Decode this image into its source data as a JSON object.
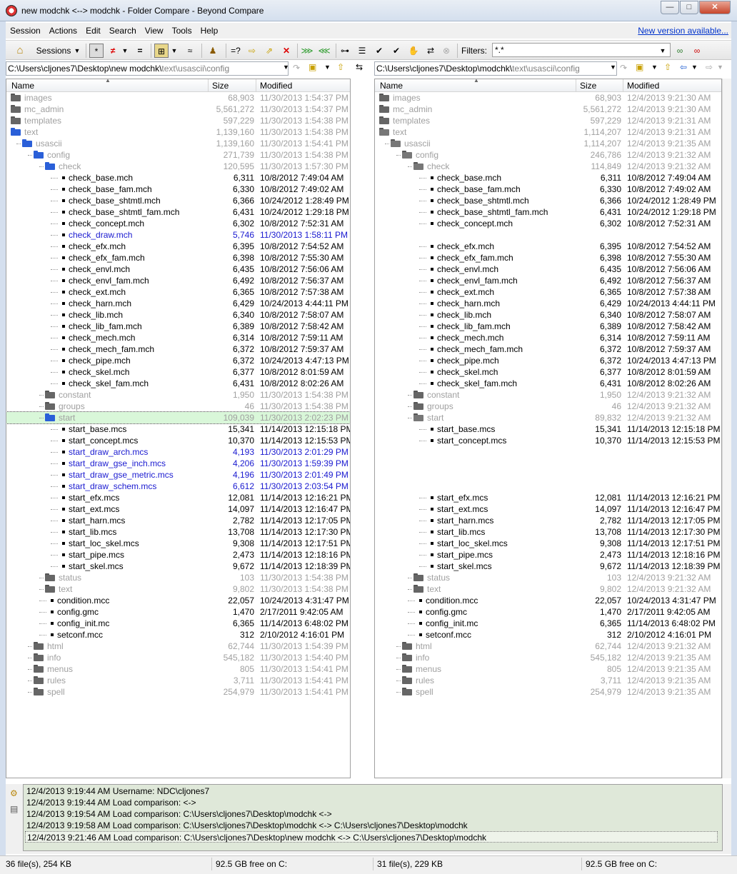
{
  "window": {
    "title": "new modchk <--> modchk - Folder Compare - Beyond Compare",
    "minimize": "—",
    "maximize": "□",
    "close": "✕"
  },
  "menu": {
    "items": [
      "Session",
      "Actions",
      "Edit",
      "Search",
      "View",
      "Tools",
      "Help"
    ],
    "new_version": "New version available..."
  },
  "toolbar": {
    "sessions_label": "Sessions",
    "filters_label": "Filters:",
    "filters_value": "*.*",
    "icons": [
      "home-icon",
      "show-all-icon",
      "show-diffs-icon",
      "show-same-icon",
      "show-structure-icon",
      "minor-icon",
      "rules-icon",
      "compare-contents-icon",
      "copy-right-icon",
      "move-icon",
      "delete-icon",
      "copy-to-right-icon",
      "copy-to-left-icon",
      "expand-icon",
      "collapse-icon",
      "select-icon",
      "select-all-icon",
      "touch-icon",
      "swap-icon",
      "stop-icon",
      "glasses-icon",
      "glasses-off-icon"
    ]
  },
  "left": {
    "path_prefix": "C:\\Users\\cljones7\\Desktop\\new modchk\\",
    "path_rest": "text\\usascii\\config"
  },
  "right": {
    "path_prefix": "C:\\Users\\cljones7\\Desktop\\modchk\\",
    "path_rest": "text\\usascii\\config"
  },
  "columns": {
    "name": "Name",
    "size": "Size",
    "modified": "Modified"
  },
  "left_rows": [
    {
      "d": 0,
      "t": "f",
      "n": "images",
      "s": "68,903",
      "m": "11/30/2013 1:54:37 PM",
      "c": "gray"
    },
    {
      "d": 0,
      "t": "f",
      "n": "mc_admin",
      "s": "5,561,272",
      "m": "11/30/2013 1:54:37 PM",
      "c": "gray"
    },
    {
      "d": 0,
      "t": "f",
      "n": "templates",
      "s": "597,229",
      "m": "11/30/2013 1:54:38 PM",
      "c": "gray"
    },
    {
      "d": 0,
      "t": "o",
      "n": "text",
      "s": "1,139,160",
      "m": "11/30/2013 1:54:38 PM",
      "c": "gray"
    },
    {
      "d": 1,
      "t": "o",
      "n": "usascii",
      "s": "1,139,160",
      "m": "11/30/2013 1:54:41 PM",
      "c": "gray"
    },
    {
      "d": 2,
      "t": "o",
      "n": "config",
      "s": "271,739",
      "m": "11/30/2013 1:54:38 PM",
      "c": "gray"
    },
    {
      "d": 3,
      "t": "o",
      "n": "check",
      "s": "120,595",
      "m": "11/30/2013 1:57:30 PM",
      "c": "gray"
    },
    {
      "d": 4,
      "t": "x",
      "n": "check_base.mch",
      "s": "6,311",
      "m": "10/8/2012 7:49:04 AM",
      "c": ""
    },
    {
      "d": 4,
      "t": "x",
      "n": "check_base_fam.mch",
      "s": "6,330",
      "m": "10/8/2012 7:49:02 AM",
      "c": ""
    },
    {
      "d": 4,
      "t": "x",
      "n": "check_base_shtmtl.mch",
      "s": "6,366",
      "m": "10/24/2012 1:28:49 PM",
      "c": ""
    },
    {
      "d": 4,
      "t": "x",
      "n": "check_base_shtmtl_fam.mch",
      "s": "6,431",
      "m": "10/24/2012 1:29:18 PM",
      "c": ""
    },
    {
      "d": 4,
      "t": "x",
      "n": "check_concept.mch",
      "s": "6,302",
      "m": "10/8/2012 7:52:31 AM",
      "c": ""
    },
    {
      "d": 4,
      "t": "x",
      "n": "check_draw.mch",
      "s": "5,746",
      "m": "11/30/2013 1:58:11 PM",
      "c": "blue"
    },
    {
      "d": 4,
      "t": "x",
      "n": "check_efx.mch",
      "s": "6,395",
      "m": "10/8/2012 7:54:52 AM",
      "c": ""
    },
    {
      "d": 4,
      "t": "x",
      "n": "check_efx_fam.mch",
      "s": "6,398",
      "m": "10/8/2012 7:55:30 AM",
      "c": ""
    },
    {
      "d": 4,
      "t": "x",
      "n": "check_envl.mch",
      "s": "6,435",
      "m": "10/8/2012 7:56:06 AM",
      "c": ""
    },
    {
      "d": 4,
      "t": "x",
      "n": "check_envl_fam.mch",
      "s": "6,492",
      "m": "10/8/2012 7:56:37 AM",
      "c": ""
    },
    {
      "d": 4,
      "t": "x",
      "n": "check_ext.mch",
      "s": "6,365",
      "m": "10/8/2012 7:57:38 AM",
      "c": ""
    },
    {
      "d": 4,
      "t": "x",
      "n": "check_harn.mch",
      "s": "6,429",
      "m": "10/24/2013 4:44:11 PM",
      "c": ""
    },
    {
      "d": 4,
      "t": "x",
      "n": "check_lib.mch",
      "s": "6,340",
      "m": "10/8/2012 7:58:07 AM",
      "c": ""
    },
    {
      "d": 4,
      "t": "x",
      "n": "check_lib_fam.mch",
      "s": "6,389",
      "m": "10/8/2012 7:58:42 AM",
      "c": ""
    },
    {
      "d": 4,
      "t": "x",
      "n": "check_mech.mch",
      "s": "6,314",
      "m": "10/8/2012 7:59:11 AM",
      "c": ""
    },
    {
      "d": 4,
      "t": "x",
      "n": "check_mech_fam.mch",
      "s": "6,372",
      "m": "10/8/2012 7:59:37 AM",
      "c": ""
    },
    {
      "d": 4,
      "t": "x",
      "n": "check_pipe.mch",
      "s": "6,372",
      "m": "10/24/2013 4:47:13 PM",
      "c": ""
    },
    {
      "d": 4,
      "t": "x",
      "n": "check_skel.mch",
      "s": "6,377",
      "m": "10/8/2012 8:01:59 AM",
      "c": ""
    },
    {
      "d": 4,
      "t": "x",
      "n": "check_skel_fam.mch",
      "s": "6,431",
      "m": "10/8/2012 8:02:26 AM",
      "c": ""
    },
    {
      "d": 3,
      "t": "f",
      "n": "constant",
      "s": "1,950",
      "m": "11/30/2013 1:54:38 PM",
      "c": "gray"
    },
    {
      "d": 3,
      "t": "f",
      "n": "groups",
      "s": "46",
      "m": "11/30/2013 1:54:38 PM",
      "c": "gray"
    },
    {
      "d": 3,
      "t": "o",
      "n": "start",
      "s": "109,039",
      "m": "11/30/2013 2:02:23 PM",
      "c": "gray",
      "sel": true
    },
    {
      "d": 4,
      "t": "x",
      "n": "start_base.mcs",
      "s": "15,341",
      "m": "11/14/2013 12:15:18 PM",
      "c": ""
    },
    {
      "d": 4,
      "t": "x",
      "n": "start_concept.mcs",
      "s": "10,370",
      "m": "11/14/2013 12:15:53 PM",
      "c": ""
    },
    {
      "d": 4,
      "t": "x",
      "n": "start_draw_arch.mcs",
      "s": "4,193",
      "m": "11/30/2013 2:01:29 PM",
      "c": "blue"
    },
    {
      "d": 4,
      "t": "x",
      "n": "start_draw_gse_inch.mcs",
      "s": "4,206",
      "m": "11/30/2013 1:59:39 PM",
      "c": "blue"
    },
    {
      "d": 4,
      "t": "x",
      "n": "start_draw_gse_metric.mcs",
      "s": "4,196",
      "m": "11/30/2013 2:01:49 PM",
      "c": "blue"
    },
    {
      "d": 4,
      "t": "x",
      "n": "start_draw_schem.mcs",
      "s": "6,612",
      "m": "11/30/2013 2:03:54 PM",
      "c": "blue"
    },
    {
      "d": 4,
      "t": "x",
      "n": "start_efx.mcs",
      "s": "12,081",
      "m": "11/14/2013 12:16:21 PM",
      "c": ""
    },
    {
      "d": 4,
      "t": "x",
      "n": "start_ext.mcs",
      "s": "14,097",
      "m": "11/14/2013 12:16:47 PM",
      "c": ""
    },
    {
      "d": 4,
      "t": "x",
      "n": "start_harn.mcs",
      "s": "2,782",
      "m": "11/14/2013 12:17:05 PM",
      "c": ""
    },
    {
      "d": 4,
      "t": "x",
      "n": "start_lib.mcs",
      "s": "13,708",
      "m": "11/14/2013 12:17:30 PM",
      "c": ""
    },
    {
      "d": 4,
      "t": "x",
      "n": "start_loc_skel.mcs",
      "s": "9,308",
      "m": "11/14/2013 12:17:51 PM",
      "c": ""
    },
    {
      "d": 4,
      "t": "x",
      "n": "start_pipe.mcs",
      "s": "2,473",
      "m": "11/14/2013 12:18:16 PM",
      "c": ""
    },
    {
      "d": 4,
      "t": "x",
      "n": "start_skel.mcs",
      "s": "9,672",
      "m": "11/14/2013 12:18:39 PM",
      "c": ""
    },
    {
      "d": 3,
      "t": "f",
      "n": "status",
      "s": "103",
      "m": "11/30/2013 1:54:38 PM",
      "c": "gray"
    },
    {
      "d": 3,
      "t": "f",
      "n": "text",
      "s": "9,802",
      "m": "11/30/2013 1:54:38 PM",
      "c": "gray"
    },
    {
      "d": 3,
      "t": "x",
      "n": "condition.mcc",
      "s": "22,057",
      "m": "10/24/2013 4:31:47 PM",
      "c": ""
    },
    {
      "d": 3,
      "t": "x",
      "n": "config.gmc",
      "s": "1,470",
      "m": "2/17/2011 9:42:05 AM",
      "c": ""
    },
    {
      "d": 3,
      "t": "x",
      "n": "config_init.mc",
      "s": "6,365",
      "m": "11/14/2013 6:48:02 PM",
      "c": ""
    },
    {
      "d": 3,
      "t": "x",
      "n": "setconf.mcc",
      "s": "312",
      "m": "2/10/2012 4:16:01 PM",
      "c": ""
    },
    {
      "d": 2,
      "t": "f",
      "n": "html",
      "s": "62,744",
      "m": "11/30/2013 1:54:39 PM",
      "c": "gray"
    },
    {
      "d": 2,
      "t": "f",
      "n": "info",
      "s": "545,182",
      "m": "11/30/2013 1:54:40 PM",
      "c": "gray"
    },
    {
      "d": 2,
      "t": "f",
      "n": "menus",
      "s": "805",
      "m": "11/30/2013 1:54:41 PM",
      "c": "gray"
    },
    {
      "d": 2,
      "t": "f",
      "n": "rules",
      "s": "3,711",
      "m": "11/30/2013 1:54:41 PM",
      "c": "gray"
    },
    {
      "d": 2,
      "t": "f",
      "n": "spell",
      "s": "254,979",
      "m": "11/30/2013 1:54:41 PM",
      "c": "gray"
    }
  ],
  "right_rows": [
    {
      "d": 0,
      "t": "f",
      "n": "images",
      "s": "68,903",
      "m": "12/4/2013 9:21:30 AM",
      "c": "gray"
    },
    {
      "d": 0,
      "t": "f",
      "n": "mc_admin",
      "s": "5,561,272",
      "m": "12/4/2013 9:21:30 AM",
      "c": "gray"
    },
    {
      "d": 0,
      "t": "f",
      "n": "templates",
      "s": "597,229",
      "m": "12/4/2013 9:21:31 AM",
      "c": "gray"
    },
    {
      "d": 0,
      "t": "g",
      "n": "text",
      "s": "1,114,207",
      "m": "12/4/2013 9:21:31 AM",
      "c": "gray"
    },
    {
      "d": 1,
      "t": "g",
      "n": "usascii",
      "s": "1,114,207",
      "m": "12/4/2013 9:21:35 AM",
      "c": "gray"
    },
    {
      "d": 2,
      "t": "g",
      "n": "config",
      "s": "246,786",
      "m": "12/4/2013 9:21:32 AM",
      "c": "gray"
    },
    {
      "d": 3,
      "t": "g",
      "n": "check",
      "s": "114,849",
      "m": "12/4/2013 9:21:32 AM",
      "c": "gray"
    },
    {
      "d": 4,
      "t": "x",
      "n": "check_base.mch",
      "s": "6,311",
      "m": "10/8/2012 7:49:04 AM",
      "c": ""
    },
    {
      "d": 4,
      "t": "x",
      "n": "check_base_fam.mch",
      "s": "6,330",
      "m": "10/8/2012 7:49:02 AM",
      "c": ""
    },
    {
      "d": 4,
      "t": "x",
      "n": "check_base_shtmtl.mch",
      "s": "6,366",
      "m": "10/24/2012 1:28:49 PM",
      "c": ""
    },
    {
      "d": 4,
      "t": "x",
      "n": "check_base_shtmtl_fam.mch",
      "s": "6,431",
      "m": "10/24/2012 1:29:18 PM",
      "c": ""
    },
    {
      "d": 4,
      "t": "x",
      "n": "check_concept.mch",
      "s": "6,302",
      "m": "10/8/2012 7:52:31 AM",
      "c": ""
    },
    {
      "d": 4,
      "t": "e",
      "n": "",
      "s": "",
      "m": "",
      "c": ""
    },
    {
      "d": 4,
      "t": "x",
      "n": "check_efx.mch",
      "s": "6,395",
      "m": "10/8/2012 7:54:52 AM",
      "c": ""
    },
    {
      "d": 4,
      "t": "x",
      "n": "check_efx_fam.mch",
      "s": "6,398",
      "m": "10/8/2012 7:55:30 AM",
      "c": ""
    },
    {
      "d": 4,
      "t": "x",
      "n": "check_envl.mch",
      "s": "6,435",
      "m": "10/8/2012 7:56:06 AM",
      "c": ""
    },
    {
      "d": 4,
      "t": "x",
      "n": "check_envl_fam.mch",
      "s": "6,492",
      "m": "10/8/2012 7:56:37 AM",
      "c": ""
    },
    {
      "d": 4,
      "t": "x",
      "n": "check_ext.mch",
      "s": "6,365",
      "m": "10/8/2012 7:57:38 AM",
      "c": ""
    },
    {
      "d": 4,
      "t": "x",
      "n": "check_harn.mch",
      "s": "6,429",
      "m": "10/24/2013 4:44:11 PM",
      "c": ""
    },
    {
      "d": 4,
      "t": "x",
      "n": "check_lib.mch",
      "s": "6,340",
      "m": "10/8/2012 7:58:07 AM",
      "c": ""
    },
    {
      "d": 4,
      "t": "x",
      "n": "check_lib_fam.mch",
      "s": "6,389",
      "m": "10/8/2012 7:58:42 AM",
      "c": ""
    },
    {
      "d": 4,
      "t": "x",
      "n": "check_mech.mch",
      "s": "6,314",
      "m": "10/8/2012 7:59:11 AM",
      "c": ""
    },
    {
      "d": 4,
      "t": "x",
      "n": "check_mech_fam.mch",
      "s": "6,372",
      "m": "10/8/2012 7:59:37 AM",
      "c": ""
    },
    {
      "d": 4,
      "t": "x",
      "n": "check_pipe.mch",
      "s": "6,372",
      "m": "10/24/2013 4:47:13 PM",
      "c": ""
    },
    {
      "d": 4,
      "t": "x",
      "n": "check_skel.mch",
      "s": "6,377",
      "m": "10/8/2012 8:01:59 AM",
      "c": ""
    },
    {
      "d": 4,
      "t": "x",
      "n": "check_skel_fam.mch",
      "s": "6,431",
      "m": "10/8/2012 8:02:26 AM",
      "c": ""
    },
    {
      "d": 3,
      "t": "f",
      "n": "constant",
      "s": "1,950",
      "m": "12/4/2013 9:21:32 AM",
      "c": "gray"
    },
    {
      "d": 3,
      "t": "f",
      "n": "groups",
      "s": "46",
      "m": "12/4/2013 9:21:32 AM",
      "c": "gray"
    },
    {
      "d": 3,
      "t": "g",
      "n": "start",
      "s": "89,832",
      "m": "12/4/2013 9:21:32 AM",
      "c": "gray"
    },
    {
      "d": 4,
      "t": "x",
      "n": "start_base.mcs",
      "s": "15,341",
      "m": "11/14/2013 12:15:18 PM",
      "c": ""
    },
    {
      "d": 4,
      "t": "x",
      "n": "start_concept.mcs",
      "s": "10,370",
      "m": "11/14/2013 12:15:53 PM",
      "c": ""
    },
    {
      "d": 4,
      "t": "e",
      "n": "",
      "s": "",
      "m": "",
      "c": ""
    },
    {
      "d": 4,
      "t": "e",
      "n": "",
      "s": "",
      "m": "",
      "c": ""
    },
    {
      "d": 4,
      "t": "e",
      "n": "",
      "s": "",
      "m": "",
      "c": ""
    },
    {
      "d": 4,
      "t": "e",
      "n": "",
      "s": "",
      "m": "",
      "c": ""
    },
    {
      "d": 4,
      "t": "x",
      "n": "start_efx.mcs",
      "s": "12,081",
      "m": "11/14/2013 12:16:21 PM",
      "c": ""
    },
    {
      "d": 4,
      "t": "x",
      "n": "start_ext.mcs",
      "s": "14,097",
      "m": "11/14/2013 12:16:47 PM",
      "c": ""
    },
    {
      "d": 4,
      "t": "x",
      "n": "start_harn.mcs",
      "s": "2,782",
      "m": "11/14/2013 12:17:05 PM",
      "c": ""
    },
    {
      "d": 4,
      "t": "x",
      "n": "start_lib.mcs",
      "s": "13,708",
      "m": "11/14/2013 12:17:30 PM",
      "c": ""
    },
    {
      "d": 4,
      "t": "x",
      "n": "start_loc_skel.mcs",
      "s": "9,308",
      "m": "11/14/2013 12:17:51 PM",
      "c": ""
    },
    {
      "d": 4,
      "t": "x",
      "n": "start_pipe.mcs",
      "s": "2,473",
      "m": "11/14/2013 12:18:16 PM",
      "c": ""
    },
    {
      "d": 4,
      "t": "x",
      "n": "start_skel.mcs",
      "s": "9,672",
      "m": "11/14/2013 12:18:39 PM",
      "c": ""
    },
    {
      "d": 3,
      "t": "f",
      "n": "status",
      "s": "103",
      "m": "12/4/2013 9:21:32 AM",
      "c": "gray"
    },
    {
      "d": 3,
      "t": "f",
      "n": "text",
      "s": "9,802",
      "m": "12/4/2013 9:21:32 AM",
      "c": "gray"
    },
    {
      "d": 3,
      "t": "x",
      "n": "condition.mcc",
      "s": "22,057",
      "m": "10/24/2013 4:31:47 PM",
      "c": ""
    },
    {
      "d": 3,
      "t": "x",
      "n": "config.gmc",
      "s": "1,470",
      "m": "2/17/2011 9:42:05 AM",
      "c": ""
    },
    {
      "d": 3,
      "t": "x",
      "n": "config_init.mc",
      "s": "6,365",
      "m": "11/14/2013 6:48:02 PM",
      "c": ""
    },
    {
      "d": 3,
      "t": "x",
      "n": "setconf.mcc",
      "s": "312",
      "m": "2/10/2012 4:16:01 PM",
      "c": ""
    },
    {
      "d": 2,
      "t": "f",
      "n": "html",
      "s": "62,744",
      "m": "12/4/2013 9:21:32 AM",
      "c": "gray"
    },
    {
      "d": 2,
      "t": "f",
      "n": "info",
      "s": "545,182",
      "m": "12/4/2013 9:21:35 AM",
      "c": "gray"
    },
    {
      "d": 2,
      "t": "f",
      "n": "menus",
      "s": "805",
      "m": "12/4/2013 9:21:35 AM",
      "c": "gray"
    },
    {
      "d": 2,
      "t": "f",
      "n": "rules",
      "s": "3,711",
      "m": "12/4/2013 9:21:35 AM",
      "c": "gray"
    },
    {
      "d": 2,
      "t": "f",
      "n": "spell",
      "s": "254,979",
      "m": "12/4/2013 9:21:35 AM",
      "c": "gray"
    }
  ],
  "log": [
    "12/4/2013 9:19:44 AM  Username: NDC\\cljones7",
    "12/4/2013 9:19:44 AM  Load comparison:  <->",
    "12/4/2013 9:19:54 AM  Load comparison: C:\\Users\\cljones7\\Desktop\\modchk <->",
    "12/4/2013 9:19:58 AM  Load comparison: C:\\Users\\cljones7\\Desktop\\modchk <-> C:\\Users\\cljones7\\Desktop\\modchk",
    "12/4/2013 9:21:46 AM  Load comparison: C:\\Users\\cljones7\\Desktop\\new modchk <-> C:\\Users\\cljones7\\Desktop\\modchk"
  ],
  "status": {
    "left_files": "36 file(s), 254 KB",
    "left_free": "92.5 GB free on C:",
    "right_files": "31 file(s), 229 KB",
    "right_free": "92.5 GB free on C:"
  },
  "colors": {
    "blue": "#1a1ad0",
    "gray": "#a0a0a0",
    "selected": "#d9f7d9",
    "log_bg": "#dfe8d9"
  }
}
